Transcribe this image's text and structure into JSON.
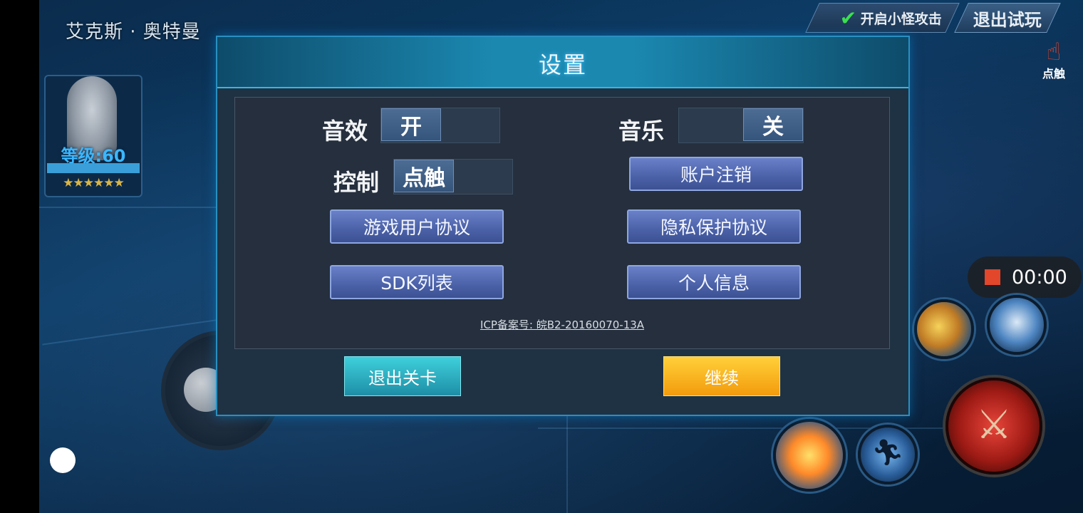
{
  "hud": {
    "character_name": "艾克斯 · 奥特曼",
    "level_label": "等级:60",
    "stars": "★★★★★★",
    "monster_attack_label": "开启小怪攻击",
    "exit_trial_label": "退出试玩",
    "touch_label": "点触",
    "record_time": "00:00"
  },
  "settings": {
    "title": "设置",
    "sound_label": "音效",
    "sound_value": "开",
    "music_label": "音乐",
    "music_value": "关",
    "control_label": "控制",
    "control_value": "点触",
    "buttons": {
      "account_cancel": "账户注销",
      "user_agreement": "游戏用户协议",
      "privacy_agreement": "隐私保护协议",
      "sdk_list": "SDK列表",
      "personal_info": "个人信息"
    },
    "icp": "ICP备案号: 皖B2-20160070-13A",
    "exit_level": "退出关卡",
    "continue": "继续"
  },
  "colors": {
    "accent_cyan": "#2a8fc0",
    "button_blue": "#4d63aa",
    "exit_button": "#1d8ea6",
    "continue_button": "#f39b0c",
    "record_dot": "#e2462b"
  }
}
